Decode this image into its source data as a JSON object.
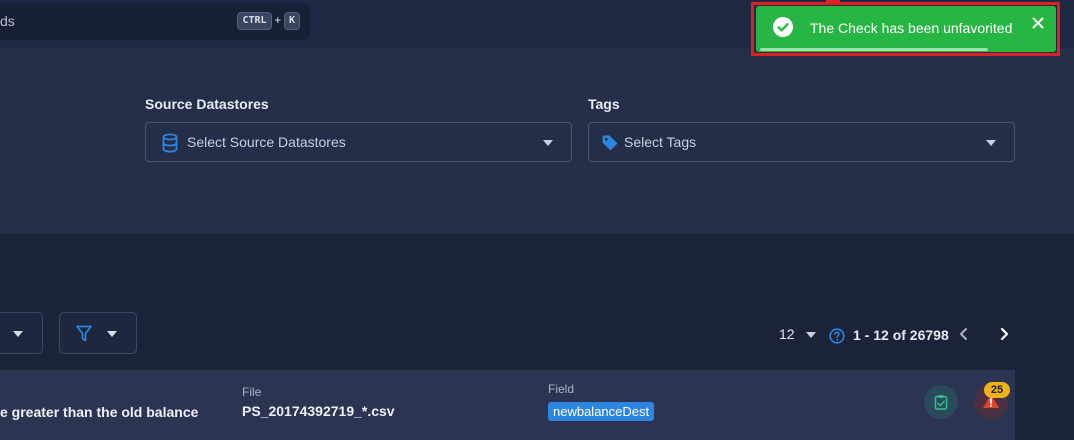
{
  "header": {
    "search": {
      "text": "ds",
      "shortcut_key1": "CTRL",
      "shortcut_plus": "+",
      "shortcut_key2": "K"
    }
  },
  "filters": {
    "source_datastores": {
      "label": "Source Datastores",
      "placeholder": "Select Source Datastores",
      "icon": "database-icon"
    },
    "tags": {
      "label": "Tags",
      "placeholder": "Select Tags",
      "icon": "tag-icon"
    }
  },
  "list": {
    "per_page": "12",
    "range_text": "1 - 12 of 26798",
    "rows": [
      {
        "description": "e greater than the old balance",
        "file_label": "File",
        "file_value": "PS_20174392719_*.csv",
        "field_label": "Field",
        "field_value": "newbalanceDest",
        "anomaly_count": "25"
      }
    ]
  },
  "toast": {
    "message": "The Check has been unfavorited",
    "progress": 0.78,
    "color": "#27b543",
    "highlight_color": "#e01f1f"
  },
  "colors": {
    "accent": "#2c86e0",
    "background": "#1d2640",
    "warning": "#f0b21a",
    "danger": "#e0452b"
  }
}
